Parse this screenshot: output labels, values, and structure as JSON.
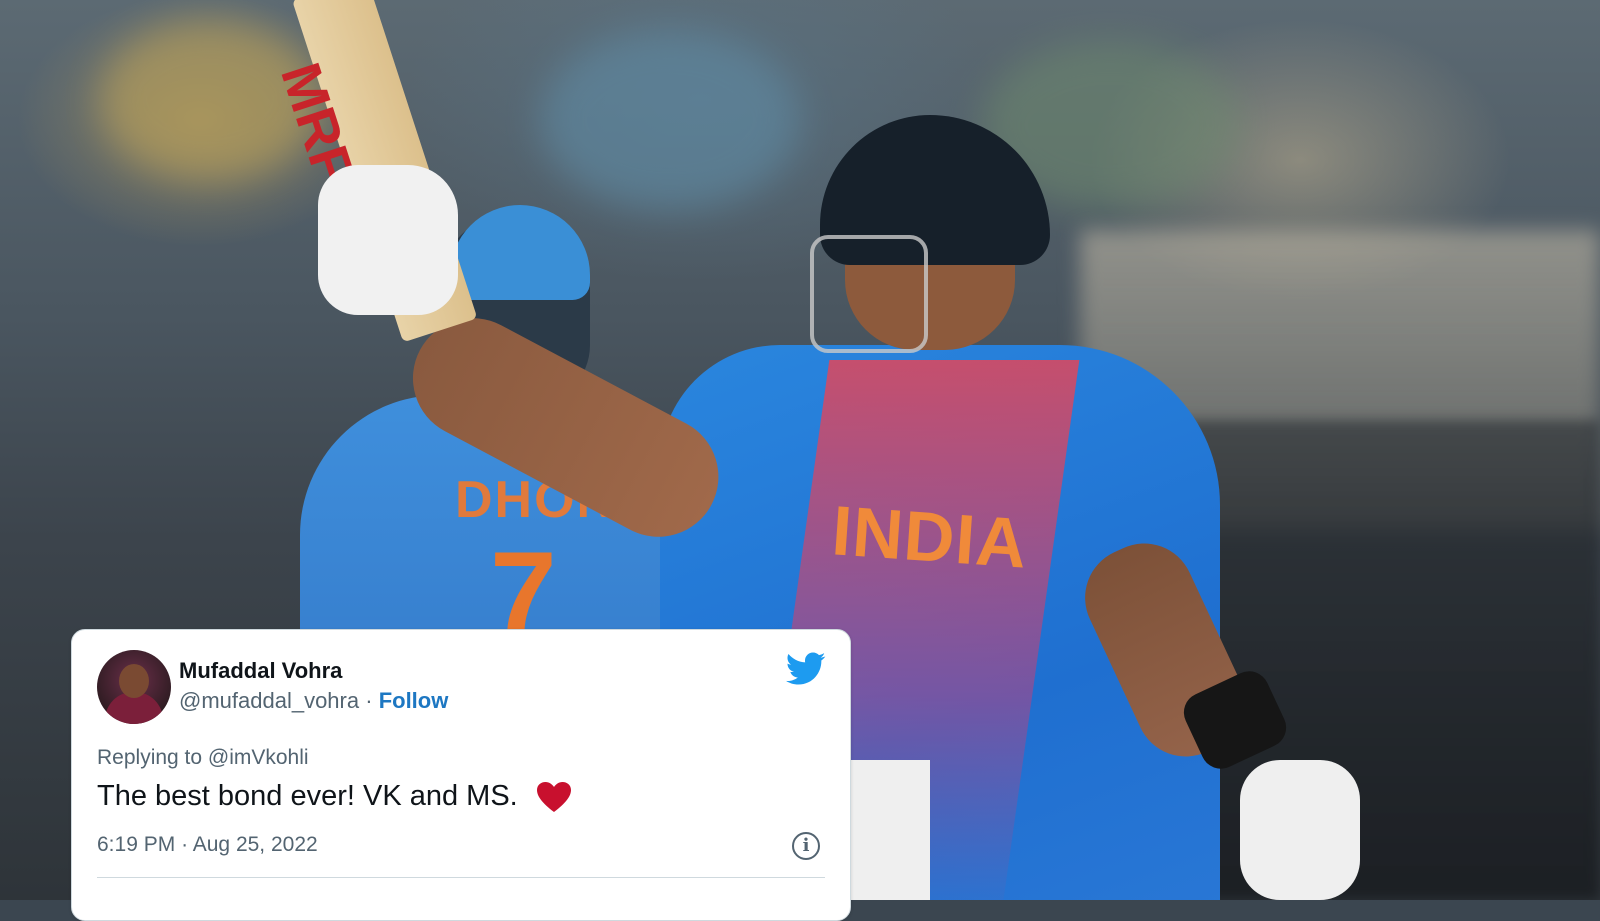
{
  "photo": {
    "jersey_back_name": "DHONI",
    "jersey_back_number": "7",
    "jersey_front": "INDIA",
    "bat_logo": "MRF"
  },
  "tweet": {
    "author_name": "Mufaddal Vohra",
    "handle": "@mufaddal_vohra",
    "separator": "·",
    "follow_label": "Follow",
    "replying_to": "Replying to @imVkohli",
    "text": "The best bond ever! VK and MS.",
    "time": "6:19 PM",
    "date": "Aug 25, 2022",
    "meta_separator": "·",
    "icons": {
      "brand": "twitter-bird-icon",
      "emoji": "red-heart-icon",
      "info": "info-icon"
    },
    "colors": {
      "follow": "#1d77c2",
      "bird": "#1d9bf0",
      "heart": "#c8102e",
      "text": "#0f1419",
      "muted": "#536471"
    }
  }
}
